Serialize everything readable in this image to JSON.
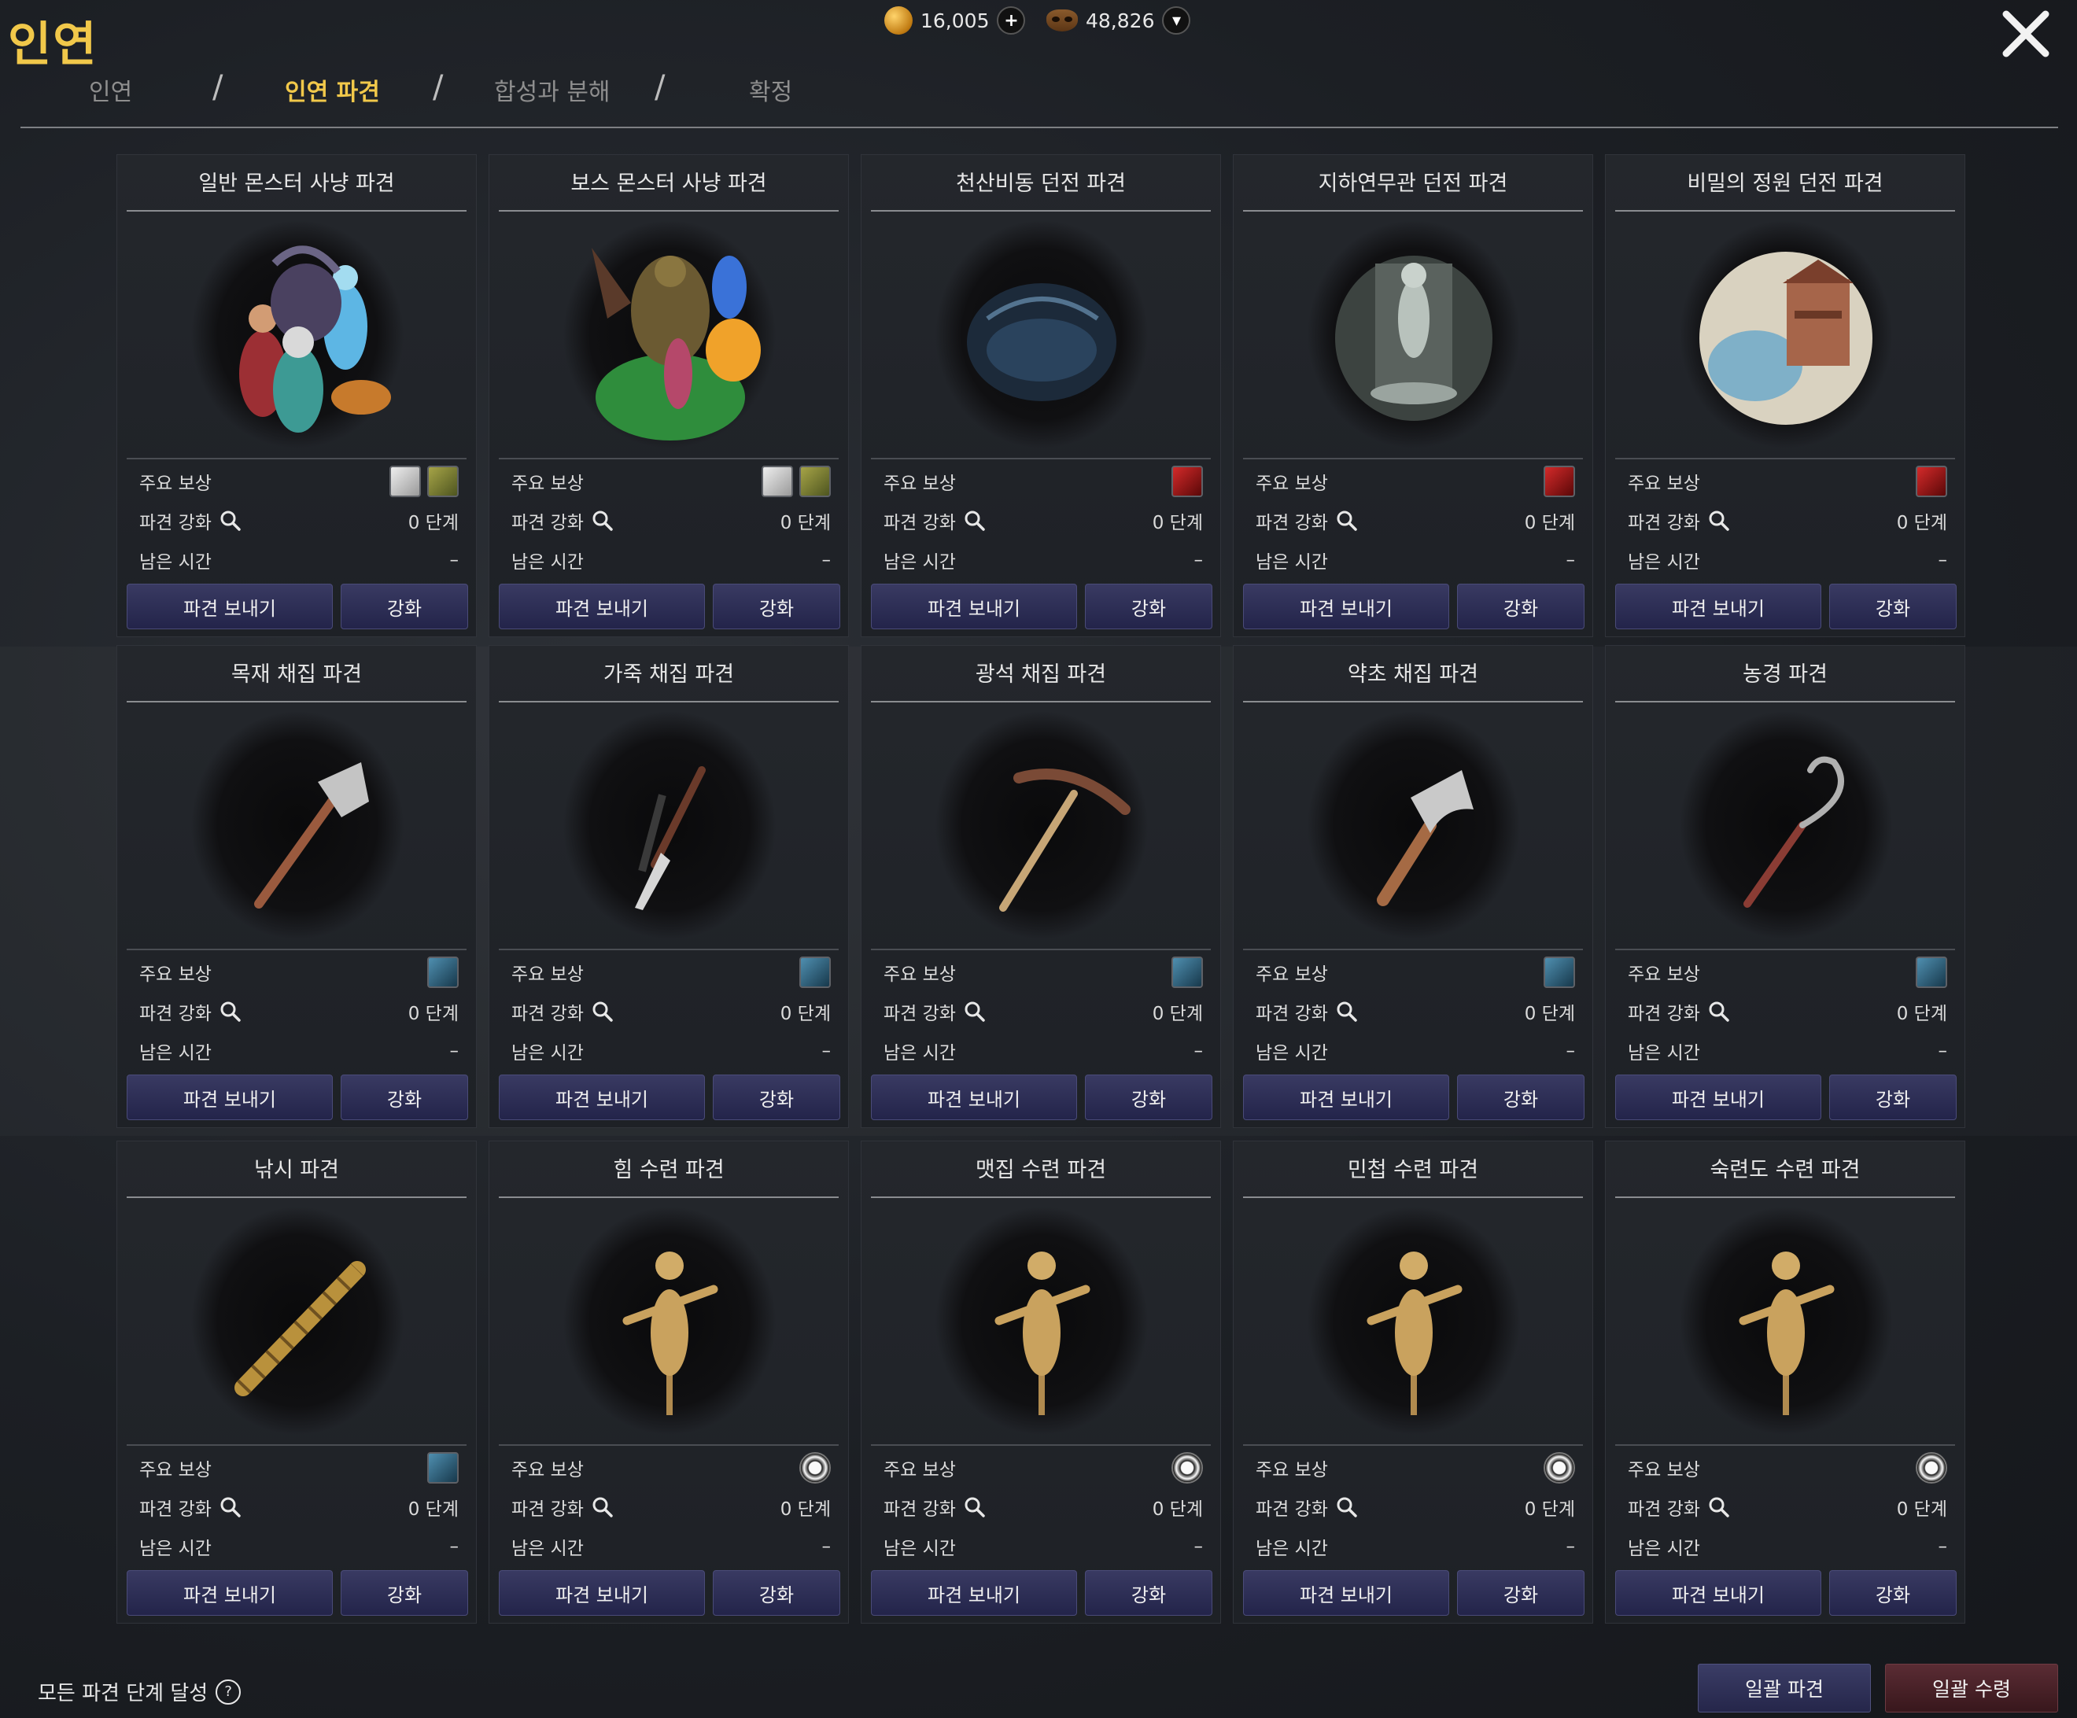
{
  "app": {
    "title": "인연"
  },
  "tabs": [
    {
      "label": "인연",
      "active": false
    },
    {
      "label": "인연 파견",
      "active": true
    },
    {
      "label": "합성과 분해",
      "active": false
    },
    {
      "label": "확정",
      "active": false
    }
  ],
  "tab_separator": "/",
  "currency": [
    {
      "icon": "gold-coin-icon",
      "value": "16,005",
      "action_icon": "plus-icon",
      "action_glyph": "+"
    },
    {
      "icon": "mask-token-icon",
      "value": "48,826",
      "action_icon": "dropdown-arrow-icon",
      "action_glyph": "▾"
    }
  ],
  "labels": {
    "main_reward": "주요 보상",
    "enhance_level": "파견 강화",
    "time_left": "남은 시간",
    "dispatch_button": "파견 보내기",
    "enhance_button": "강화"
  },
  "cards": [
    {
      "title": "일반 몬스터 사냥 파견",
      "art": "monster-group",
      "rewards": [
        "book",
        "bag"
      ],
      "stage": "0 단계",
      "time": "–"
    },
    {
      "title": "보스 몬스터 사냥 파견",
      "art": "boss-group",
      "rewards": [
        "book",
        "bag"
      ],
      "stage": "0 단계",
      "time": "–"
    },
    {
      "title": "천산비동 던전 파견",
      "art": "cave",
      "rewards": [
        "chest"
      ],
      "stage": "0 단계",
      "time": "–"
    },
    {
      "title": "지하연무관 던전 파견",
      "art": "shrine",
      "rewards": [
        "chest"
      ],
      "stage": "0 단계",
      "time": "–"
    },
    {
      "title": "비밀의 정원 던전 파견",
      "art": "garden",
      "rewards": [
        "chest"
      ],
      "stage": "0 단계",
      "time": "–"
    },
    {
      "title": "목재 채집 파견",
      "art": "axe",
      "rewards": [
        "box"
      ],
      "stage": "0 단계",
      "time": "–"
    },
    {
      "title": "가죽 채집 파견",
      "art": "knife",
      "rewards": [
        "box"
      ],
      "stage": "0 단계",
      "time": "–"
    },
    {
      "title": "광석 채집 파견",
      "art": "pickaxe",
      "rewards": [
        "box"
      ],
      "stage": "0 단계",
      "time": "–"
    },
    {
      "title": "약초 채집 파견",
      "art": "hoe",
      "rewards": [
        "box"
      ],
      "stage": "0 단계",
      "time": "–"
    },
    {
      "title": "농경 파견",
      "art": "sickle",
      "rewards": [
        "box"
      ],
      "stage": "0 단계",
      "time": "–"
    },
    {
      "title": "낚시 파견",
      "art": "rod",
      "rewards": [
        "box"
      ],
      "stage": "0 단계",
      "time": "–"
    },
    {
      "title": "힘 수련 파견",
      "art": "dummy",
      "rewards": [
        "emblem"
      ],
      "stage": "0 단계",
      "time": "–"
    },
    {
      "title": "맷집 수련 파견",
      "art": "dummy",
      "rewards": [
        "emblem"
      ],
      "stage": "0 단계",
      "time": "–"
    },
    {
      "title": "민첩 수련 파견",
      "art": "dummy",
      "rewards": [
        "emblem"
      ],
      "stage": "0 단계",
      "time": "–"
    },
    {
      "title": "숙련도 수련 파견",
      "art": "dummy",
      "rewards": [
        "emblem"
      ],
      "stage": "0 단계",
      "time": "–"
    }
  ],
  "footer": {
    "note": "모든 파견 단계 달성",
    "help_glyph": "?",
    "bulk_dispatch": "일괄 파견",
    "bulk_claim": "일괄 수령"
  },
  "colors": {
    "accent_gold": "#f1c84a",
    "button_blue": "#2f3058",
    "button_red": "#4a222a"
  }
}
